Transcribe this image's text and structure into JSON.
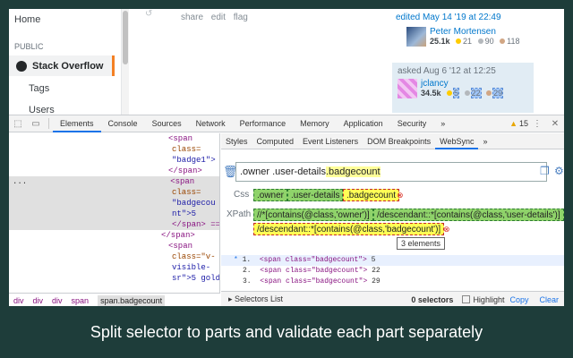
{
  "page": {
    "sidebar": {
      "home": "Home",
      "public": "PUBLIC",
      "stack_overflow": "Stack Overflow",
      "tags": "Tags",
      "users": "Users"
    },
    "post_menu": [
      "share",
      "edit",
      "flag"
    ],
    "edited": {
      "when": "edited May 14 '19 at 22:49",
      "user": "Peter Mortensen",
      "rep": "25.1k",
      "gold": "21",
      "silver": "90",
      "bronze": "118"
    },
    "asked": {
      "when": "asked Aug 6 '12 at 12:25",
      "user": "jclancy",
      "rep": "34.5k",
      "gold": "5",
      "silver": "22",
      "bronze": "29"
    }
  },
  "devtools": {
    "tabs": [
      "Elements",
      "Console",
      "Sources",
      "Network",
      "Performance",
      "Memory",
      "Application",
      "Security"
    ],
    "more": "»",
    "warnings": "15",
    "elements": [
      {
        "t": "<span"
      },
      {
        "t": "class="
      },
      {
        "t": "\"badge1\">"
      },
      {
        "t": "</span>"
      },
      {
        "t": "<span"
      },
      {
        "t": "class="
      },
      {
        "t": "\"badgecou"
      },
      {
        "t": "nt\">5"
      },
      {
        "t": "</span> =="
      },
      {
        "t": "</span>"
      },
      {
        "t": "<span"
      },
      {
        "t": "class=\"v-"
      },
      {
        "t": "visible-"
      },
      {
        "t": "sr\">5 gold"
      }
    ],
    "ellipsis": "...",
    "breadcrumbs": [
      "div",
      "div",
      "div",
      "span",
      "span.badgecount"
    ],
    "side_tabs": [
      "Styles",
      "Computed",
      "Event Listeners",
      "DOM Breakpoints",
      "WebSync",
      "»"
    ],
    "selector": {
      "prefix": ".owner .user-details ",
      "highlight": ".badgecount"
    },
    "css_label": "Css",
    "css_parts": [
      ".owner",
      ".user-details",
      ".badgecount"
    ],
    "xpath_label": "XPath",
    "xpath_parts": [
      "//*[contains(@class,'owner')]",
      "/descendant::*[contains(@class,'user-details')]",
      "/descendant::*[contains(@class,'badgecount')]"
    ],
    "results": [
      {
        "n": "1.",
        "code": "<span class=\"badgecount\">",
        "v": "5"
      },
      {
        "n": "2.",
        "code": "<span class=\"badgecount\">",
        "v": "22"
      },
      {
        "n": "3.",
        "code": "<span class=\"badgecount\">",
        "v": "29"
      }
    ],
    "tooltip": "3 elements",
    "footer": {
      "list": "Selectors List",
      "count": "0 selectors",
      "highlight": "Highlight",
      "copy": "Copy",
      "clear": "Clear"
    }
  },
  "caption": "Split selector to parts and validate each part separately"
}
